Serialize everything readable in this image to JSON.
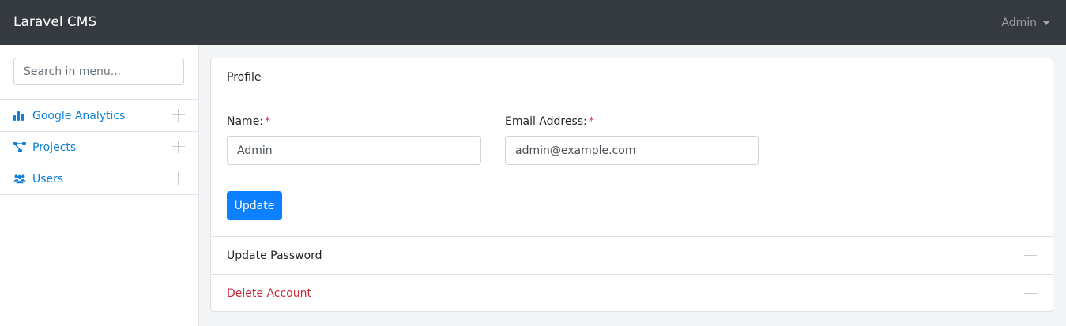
{
  "app": {
    "brand": "Laravel CMS",
    "user_menu_label": "Admin"
  },
  "sidebar": {
    "search_placeholder": "Search in menu...",
    "items": [
      {
        "label": "Google Analytics",
        "icon": "chart-bar-icon"
      },
      {
        "label": "Projects",
        "icon": "project-diagram-icon"
      },
      {
        "label": "Users",
        "icon": "users-icon"
      }
    ]
  },
  "profile": {
    "title": "Profile",
    "name_label": "Name:",
    "name_value": "Admin",
    "email_label": "Email Address:",
    "email_value": "admin@example.com",
    "required_mark": "*",
    "update_label": "Update"
  },
  "sections": {
    "password_title": "Update Password",
    "delete_title": "Delete Account"
  },
  "colors": {
    "accent": "#0d80ff",
    "danger": "#c72b3a",
    "topbar": "#343a40"
  }
}
